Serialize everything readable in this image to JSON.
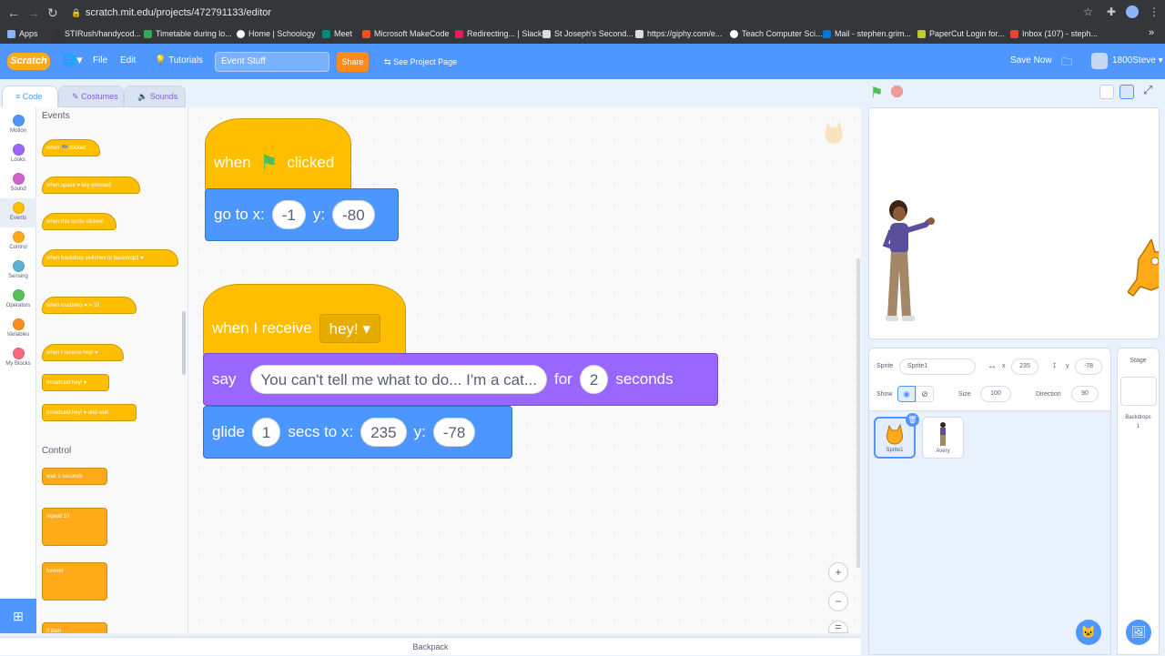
{
  "browser": {
    "url": "scratch.mit.edu/projects/472791133/editor",
    "bookmarks": [
      "Apps",
      "STIRush/handycod...",
      "Timetable during lo...",
      "Home | Schoology",
      "Meet",
      "Microsoft MakeCode",
      "Redirecting... | Slack",
      "St Joseph's Second...",
      "https://giphy.com/e...",
      "Teach Computer Sci...",
      "Mail - stephen.grim...",
      "PaperCut Login for...",
      "Inbox (107) - steph..."
    ]
  },
  "menubar": {
    "logo": "Scratch",
    "file": "File",
    "edit": "Edit",
    "tutorials": "Tutorials",
    "project_title": "Event Stuff",
    "share": "Share",
    "see_project": "See Project Page",
    "save_now": "Save Now",
    "username": "1800Steve"
  },
  "tabs": {
    "code": "Code",
    "costumes": "Costumes",
    "sounds": "Sounds"
  },
  "categories": [
    {
      "label": "Motion",
      "color": "#4c97ff"
    },
    {
      "label": "Looks",
      "color": "#9966ff"
    },
    {
      "label": "Sound",
      "color": "#cf63cf"
    },
    {
      "label": "Events",
      "color": "#ffbf00"
    },
    {
      "label": "Control",
      "color": "#ffab19"
    },
    {
      "label": "Sensing",
      "color": "#5cb1d6"
    },
    {
      "label": "Operators",
      "color": "#59c059"
    },
    {
      "label": "Variables",
      "color": "#ff8c1a"
    },
    {
      "label": "My Blocks",
      "color": "#ff6680"
    }
  ],
  "palette": {
    "events_heading": "Events",
    "control_heading": "Control",
    "events_blocks": [
      "when 🏁 clicked",
      "when  space ▾  key pressed",
      "when this sprite clicked",
      "when backdrop switches to  backdrop1 ▾",
      "when  loudness ▾  >  10",
      "when I receive  hey! ▾",
      "broadcast  hey! ▾",
      "broadcast  hey! ▾  and wait"
    ],
    "control_blocks": [
      "wait  1  seconds",
      "repeat  10",
      "forever",
      "if   then"
    ]
  },
  "script1": {
    "when": "when",
    "clicked": "clicked",
    "goto": "go to x:",
    "x": "-1",
    "y_label": "y:",
    "y": "-80"
  },
  "script2": {
    "when_receive": "when I receive",
    "message": "hey! ▾",
    "say": "say",
    "say_text": "You can't tell me what to do... I'm a cat...",
    "for": "for",
    "secs": "2",
    "seconds": "seconds",
    "glide": "glide",
    "glide_secs": "1",
    "secs_to": "secs to x:",
    "gx": "235",
    "gy_label": "y:",
    "gy": "-78"
  },
  "backpack": "Backpack",
  "sprite_info": {
    "sprite_label": "Sprite",
    "sprite_name": "Sprite1",
    "x_label": "x",
    "x": "235",
    "y_label": "y",
    "y": "-78",
    "show_label": "Show",
    "size_label": "Size",
    "size": "100",
    "direction_label": "Direction",
    "direction": "90"
  },
  "sprites": [
    "Sprite1",
    "Avery"
  ],
  "stage_panel": {
    "label": "Stage",
    "backdrops_label": "Backdrops",
    "backdrops_count": "1"
  }
}
